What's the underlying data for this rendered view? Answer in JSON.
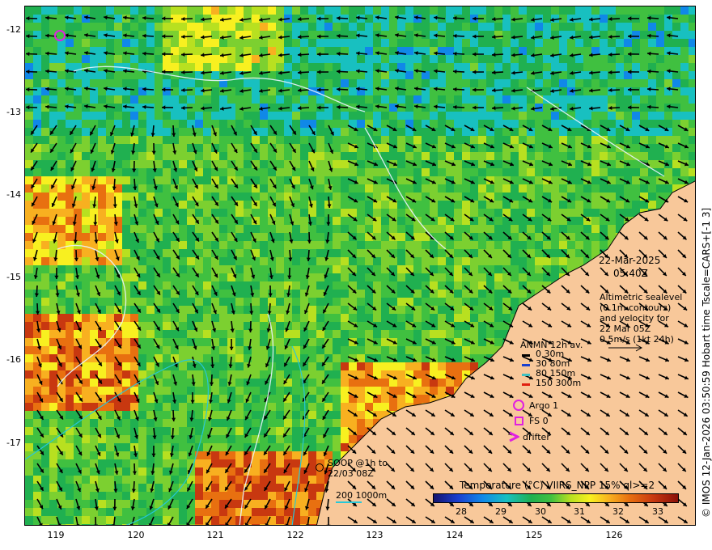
{
  "map": {
    "y_ticks": [
      "-12",
      "-13",
      "-14",
      "-15",
      "-16",
      "-17"
    ],
    "x_ticks": [
      "119",
      "120",
      "121",
      "122",
      "123",
      "124",
      "125",
      "126"
    ],
    "date": "22-Mar-2025",
    "time": "05:40Z",
    "description_lines": [
      "Altimetric sealevel",
      "(0.1m contours)",
      "and velocity for",
      "22 Mar 05Z",
      "0.5m/s (1kt 24h)"
    ],
    "anmn_title": "ANMN 12h av.",
    "anmn_items": [
      {
        "label": "0 30m",
        "color": "#000000"
      },
      {
        "label": "30 80m",
        "color": "#1a3fd0"
      },
      {
        "label": "80 150m",
        "color": "#40c0c0"
      },
      {
        "label": "150 300m",
        "color": "#e02010"
      }
    ],
    "argo_label": "Argo 1",
    "fs_label": "FS 0",
    "drifter_label": "drifter",
    "soop_lines": [
      "SOOP @1h to",
      "22/03 08Z"
    ],
    "depth_label": "200  1000m",
    "colorbar_title": "Temperature (°C) VIIRS_NPP 15% ql>=2",
    "colorbar_ticks": [
      "28",
      "29",
      "30",
      "31",
      "32",
      "33"
    ],
    "credit": "© IMOS 12-Jan-2026 03:50:59 Hobart time Tscale=CARS+[-1 3]",
    "colors": {
      "land": "#f8c89a",
      "marker": "#e020e0",
      "contour": "#e8f4ff",
      "coast": "#000000"
    }
  }
}
